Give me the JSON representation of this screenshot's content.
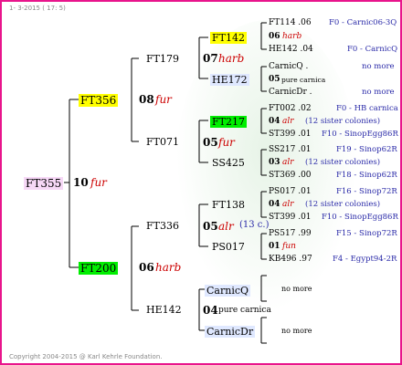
{
  "header": {
    "date": "1-  3-2015 ( 17:  5)"
  },
  "footer": {
    "copyright": "Copyright 2004-2015 @ Karl Kehrle Foundation."
  },
  "colors": {
    "border": "#e8158c",
    "highlight_yellow": "#ffff00",
    "highlight_green": "#00ee00",
    "highlight_pink": "#f6d8f6",
    "link_blue": "#2a2aa8",
    "italic_red": "#cc0000"
  },
  "gen1": {
    "code": "FT355",
    "num": "10",
    "race": "fur"
  },
  "gen2": [
    {
      "code": "FT356",
      "num": "08",
      "race": "fur"
    },
    {
      "code": "FT200",
      "num": "06",
      "race": "harb"
    }
  ],
  "gen3": [
    {
      "code": "FT179",
      "num": "07",
      "race": "harb"
    },
    {
      "code": "FT071",
      "num": "05",
      "race": "fur"
    },
    {
      "code": "FT336",
      "num": "05",
      "race": "alr",
      "extra": "(13 c.)"
    },
    {
      "code": "HE142",
      "num": "04",
      "race": "pure carnica"
    }
  ],
  "gen4": [
    {
      "code": "FT142",
      "num": "06",
      "race": "harb"
    },
    {
      "code": "HE172",
      "num": "05",
      "race": "pure carnica"
    },
    {
      "code": "FT217",
      "num": "05",
      "race": "fur"
    },
    {
      "code": "SS425",
      "num": "03",
      "race": "alr"
    },
    {
      "code": "FT138",
      "num": "04",
      "race": "alr"
    },
    {
      "code": "PS017",
      "num": "01",
      "race": "fun"
    },
    {
      "code": "CarnicQ",
      "more": "no more"
    },
    {
      "code": "CarnicDr",
      "more": "no more"
    }
  ],
  "gen5": [
    {
      "code": "FT114 .06",
      "info": "F0 - Carnic06-3Q"
    },
    {
      "num": "06",
      "race": "harb"
    },
    {
      "code": "HE142 .04",
      "info": "F0 - CarnicQ"
    },
    {
      "code": "CarnicQ .",
      "info": "no more"
    },
    {
      "num": "05",
      "race": "pure carnica"
    },
    {
      "code": "CarnicDr .",
      "info": "no more"
    },
    {
      "code": "FT002 .02",
      "info": "F0 - HB carnica"
    },
    {
      "num": "04",
      "race": "alr",
      "note": "(12 sister colonies)"
    },
    {
      "code": "ST399 .01",
      "info": "F10 - SinopEgg86R"
    },
    {
      "code": "SS217 .01",
      "info": "F19 - Sinop62R"
    },
    {
      "num": "03",
      "race": "alr",
      "note": "(12 sister colonies)"
    },
    {
      "code": "ST369 .00",
      "info": "F18 - Sinop62R"
    },
    {
      "code": "PS017 .01",
      "info": "F16 - Sinop72R"
    },
    {
      "num": "04",
      "race": "alr",
      "note": "(12 sister colonies)"
    },
    {
      "code": "ST399 .01",
      "info": "F10 - SinopEgg86R"
    },
    {
      "code": "PS517 .99",
      "info": "F15 - Sinop72R"
    },
    {
      "num": "01",
      "race": "fun"
    },
    {
      "code": "KB496 .97",
      "info": "F4 - Egypt94-2R"
    },
    {
      "info": "no more"
    },
    {
      "info": "no more"
    }
  ]
}
